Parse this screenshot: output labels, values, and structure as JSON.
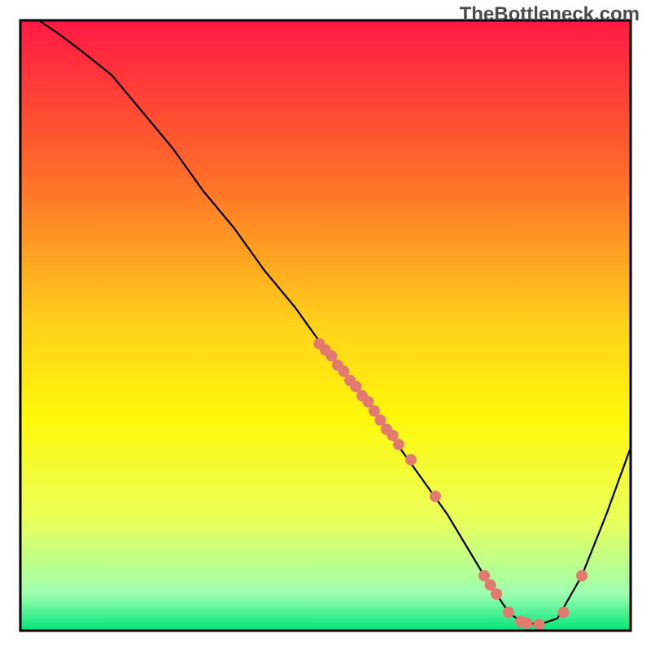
{
  "watermark": "TheBottleneck.com",
  "chart_data": {
    "type": "line",
    "title": "",
    "xlabel": "",
    "ylabel": "",
    "xlim": [
      0,
      100
    ],
    "ylim": [
      0,
      100
    ],
    "grid": false,
    "series": [
      {
        "name": "curve",
        "x": [
          3,
          6,
          10,
          15,
          20,
          25,
          30,
          35,
          40,
          45,
          50,
          55,
          60,
          65,
          70,
          73,
          76,
          78,
          80,
          82,
          85,
          88,
          92,
          96,
          100
        ],
        "y": [
          100,
          98,
          95,
          91,
          85,
          79,
          72,
          66,
          59,
          53,
          46,
          40,
          33,
          26,
          19,
          14,
          9,
          6,
          3,
          1.5,
          1,
          2,
          9,
          19,
          30
        ]
      }
    ],
    "points": {
      "name": "markers",
      "x": [
        49,
        50,
        51,
        52,
        53,
        54,
        55,
        56,
        57,
        58,
        59,
        60,
        61,
        62,
        64,
        68,
        76,
        77,
        78,
        80,
        82,
        83,
        85,
        89,
        92
      ],
      "y": [
        47,
        46,
        45,
        43.5,
        42.5,
        41,
        40,
        38.5,
        37.5,
        36,
        34.5,
        33,
        32,
        30.5,
        28,
        22,
        9,
        7.5,
        6,
        3,
        1.5,
        1.2,
        1,
        3,
        9
      ]
    },
    "gradient_background": {
      "stops": [
        {
          "offset": 0.0,
          "color": "#ff1944"
        },
        {
          "offset": 0.25,
          "color": "#ff6a2a"
        },
        {
          "offset": 0.5,
          "color": "#ffd21a"
        },
        {
          "offset": 0.65,
          "color": "#fff80a"
        },
        {
          "offset": 0.82,
          "color": "#e9ff5a"
        },
        {
          "offset": 0.94,
          "color": "#9dffb0"
        },
        {
          "offset": 1.0,
          "color": "#00e47a"
        }
      ]
    },
    "curve_color": "#000000",
    "point_color": "#e27a70",
    "frame_color": "#000000"
  }
}
